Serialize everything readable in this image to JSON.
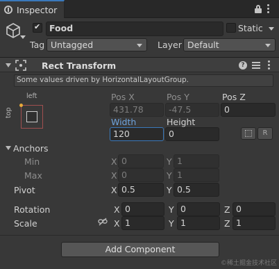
{
  "tab": {
    "title": "Inspector"
  },
  "header": {
    "object_name": "Food",
    "active": true,
    "static_label": "Static",
    "static_checked": false,
    "tag_label": "Tag",
    "tag_value": "Untagged",
    "layer_label": "Layer",
    "layer_value": "Default"
  },
  "component": {
    "title": "Rect Transform",
    "help_text": "Some values driven by HorizontalLayoutGroup.",
    "anchor_preset": {
      "horizontal": "left",
      "vertical": "top"
    },
    "pos_x_label": "Pos X",
    "pos_y_label": "Pos Y",
    "pos_z_label": "Pos Z",
    "pos_x": "431.78",
    "pos_y": "-47.5",
    "pos_z": "0",
    "width_label": "Width",
    "height_label": "Height",
    "width": "120",
    "height": "0",
    "blueprint_button": "",
    "raw_button": "R",
    "anchors_label": "Anchors",
    "min_label": "Min",
    "max_label": "Max",
    "min_x": "0",
    "min_y": "1",
    "max_x": "0",
    "max_y": "1",
    "pivot_label": "Pivot",
    "pivot_x": "0.5",
    "pivot_y": "0.5",
    "rotation_label": "Rotation",
    "rot_x": "0",
    "rot_y": "0",
    "rot_z": "0",
    "scale_label": "Scale",
    "scale_x": "1",
    "scale_y": "1",
    "scale_z": "1",
    "axis_x": "X",
    "axis_y": "Y",
    "axis_z": "Z"
  },
  "add_component": "Add Component",
  "watermark": "©稀土掘金技术社区",
  "colors": {
    "accent": "#3a79bb",
    "background": "#383838",
    "anchor_dot": "#e7a93a"
  }
}
